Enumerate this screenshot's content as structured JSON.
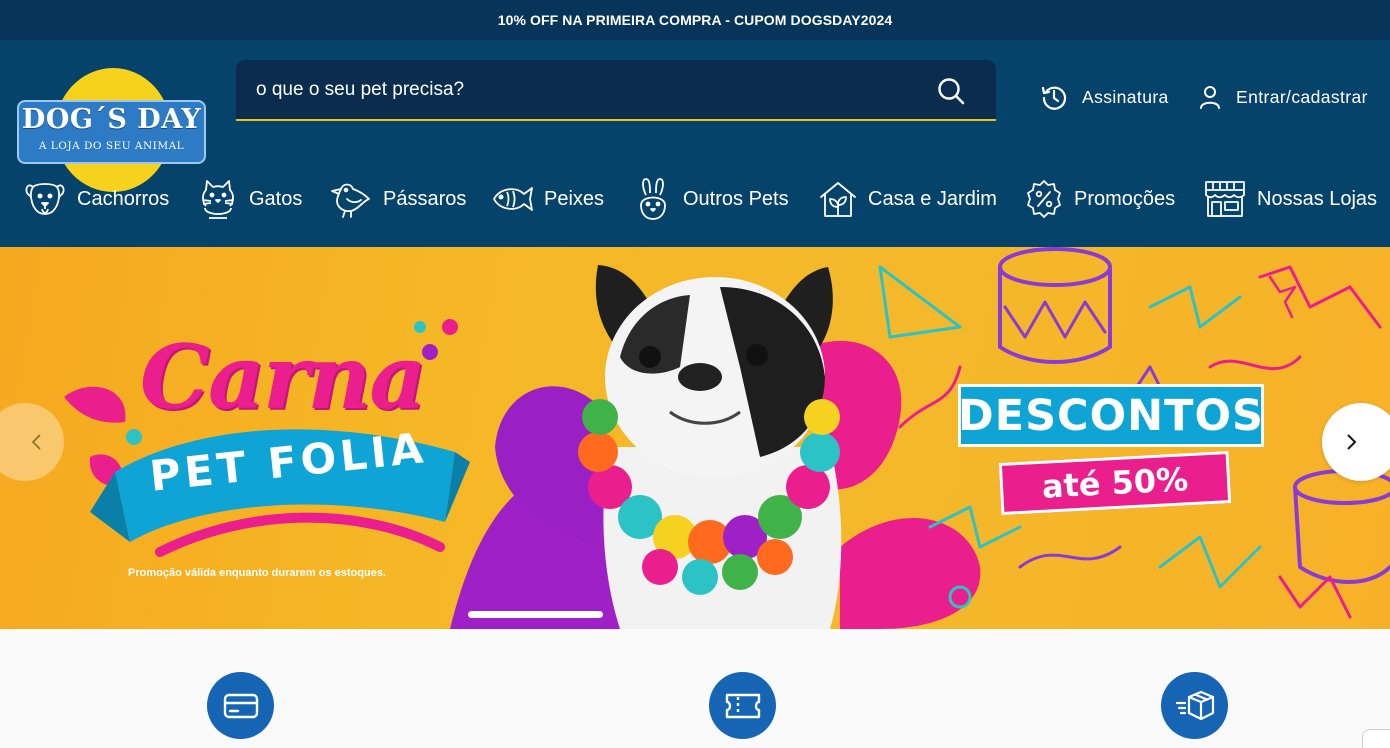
{
  "promo_bar": {
    "text": "10% OFF NA PRIMEIRA COMPRA - CUPOM DOGSDAY2024"
  },
  "logo": {
    "name": "DOG´S DAY",
    "tagline": "A LOJA DO SEU ANIMAL"
  },
  "search": {
    "placeholder": "o que o seu pet precisa?",
    "icon": "search-icon"
  },
  "header_links": [
    {
      "label": "Assinatura",
      "icon": "history-icon"
    },
    {
      "label": "Entrar/cadastrar",
      "icon": "user-icon"
    }
  ],
  "nav": [
    {
      "label": "Cachorros",
      "icon": "dog-icon"
    },
    {
      "label": "Gatos",
      "icon": "cat-icon"
    },
    {
      "label": "Pássaros",
      "icon": "bird-icon"
    },
    {
      "label": "Peixes",
      "icon": "fish-icon"
    },
    {
      "label": "Outros Pets",
      "icon": "rabbit-icon"
    },
    {
      "label": "Casa e Jardim",
      "icon": "house-plant-icon"
    },
    {
      "label": "Promoções",
      "icon": "percent-badge-icon"
    },
    {
      "label": "Nossas Lojas",
      "icon": "store-icon"
    }
  ],
  "banner": {
    "title_script": "Carna",
    "title_ribbon": "PET FOLIA",
    "disclaimer": "Promoção válida enquanto durarem os estoques.",
    "discount_label": "DESCONTOS",
    "discount_value": "até 50%"
  },
  "carousel": {
    "prev_icon": "chevron-left-icon",
    "next_icon": "chevron-right-icon",
    "active_slide": 1
  },
  "benefits": [
    {
      "icon": "credit-card-icon"
    },
    {
      "icon": "ticket-icon"
    },
    {
      "icon": "fast-delivery-box-icon"
    }
  ],
  "colors": {
    "header_bg": "#06436b",
    "topbar_bg": "#063559",
    "accent_yellow": "#e8c31c",
    "benefit_blue": "#1565b4",
    "banner_pink": "#ea1e8c",
    "banner_cyan": "#29a9e0"
  }
}
